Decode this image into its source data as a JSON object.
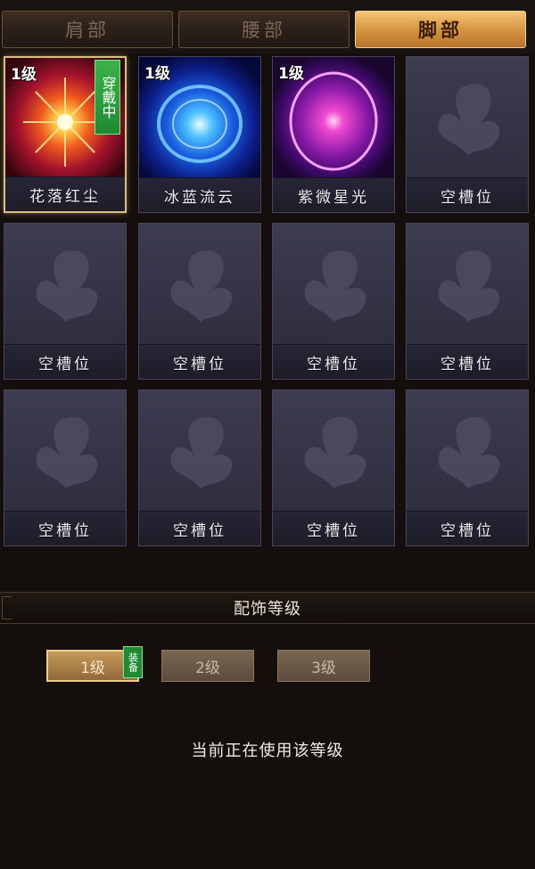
{
  "tabs": [
    {
      "label": "肩部",
      "active": false
    },
    {
      "label": "腰部",
      "active": false
    },
    {
      "label": "脚部",
      "active": true
    }
  ],
  "slots": [
    {
      "name": "花落红尘",
      "level": "1级",
      "equipped_tag": "穿戴中",
      "icon": "red-starburst-icon"
    },
    {
      "name": "冰蓝流云",
      "level": "1级",
      "icon": "blue-swirl-orb-icon"
    },
    {
      "name": "紫微星光",
      "level": "1级",
      "icon": "purple-ring-orb-icon"
    },
    {
      "name": "空槽位",
      "icon": "butterfly-icon"
    },
    {
      "name": "空槽位",
      "icon": "butterfly-icon"
    },
    {
      "name": "空槽位",
      "icon": "butterfly-icon"
    },
    {
      "name": "空槽位",
      "icon": "butterfly-icon"
    },
    {
      "name": "空槽位",
      "icon": "butterfly-icon"
    },
    {
      "name": "空槽位",
      "icon": "butterfly-icon"
    },
    {
      "name": "空槽位",
      "icon": "butterfly-icon"
    },
    {
      "name": "空槽位",
      "icon": "butterfly-icon"
    },
    {
      "name": "空槽位",
      "icon": "butterfly-icon"
    }
  ],
  "level_section": {
    "title": "配饰等级",
    "levels": [
      {
        "label": "1级",
        "active": true
      },
      {
        "label": "2级",
        "active": false
      },
      {
        "label": "3级",
        "active": false
      }
    ],
    "equip_badge": "装备",
    "status": "当前正在使用该等级"
  },
  "colors": {
    "tab_active": "#d99a45",
    "equip_green": "#1f8a31",
    "panel_bg": "#140f0c",
    "slot_bg": "#34334a"
  }
}
